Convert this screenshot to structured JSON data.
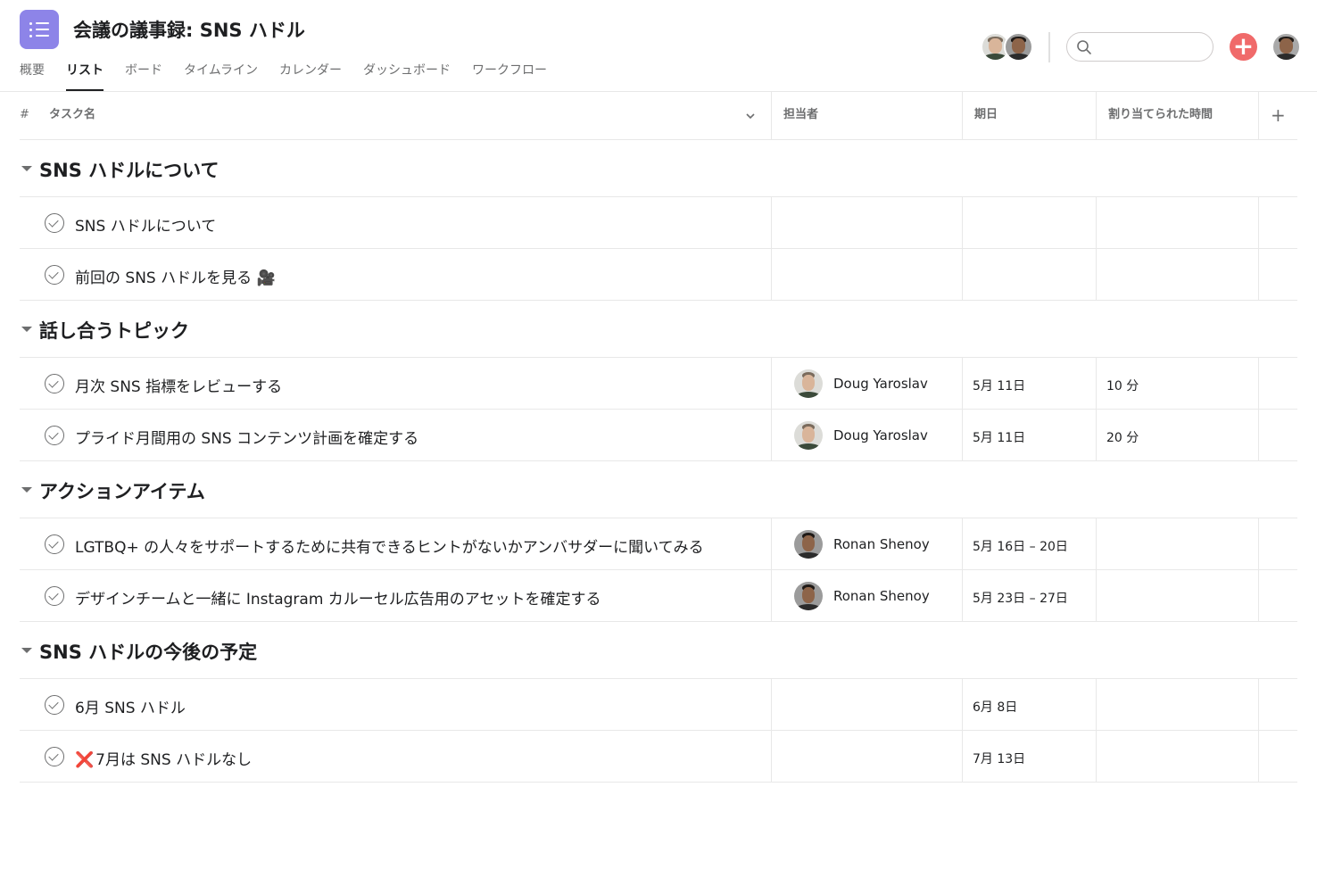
{
  "project": {
    "title": "会議の議事録: SNS ハドル",
    "icon": "list-icon",
    "accent": "#8d84e8"
  },
  "tabs": [
    {
      "label": "概要"
    },
    {
      "label": "リスト",
      "active": true
    },
    {
      "label": "ボード"
    },
    {
      "label": "タイムライン"
    },
    {
      "label": "カレンダー"
    },
    {
      "label": "ダッシュボード"
    },
    {
      "label": "ワークフロー"
    }
  ],
  "toolbar": {
    "add_label": "+",
    "add_color": "#f06a6a",
    "search_placeholder": ""
  },
  "columns": {
    "number": "#",
    "task_name": "タスク名",
    "assignee": "担当者",
    "due_date": "期日",
    "allocated_time": "割り当てられた時間",
    "add": "+"
  },
  "sections": [
    {
      "title": "SNS ハドルについて",
      "tasks": [
        {
          "name": "SNS ハドルについて",
          "assignee": "",
          "due": "",
          "time": ""
        },
        {
          "name": "前回の SNS ハドルを見る 🎥",
          "assignee": "",
          "due": "",
          "time": ""
        }
      ]
    },
    {
      "title": "話し合うトピック",
      "tasks": [
        {
          "name": "月次 SNS 指標をレビューする",
          "assignee": "Doug Yaroslav",
          "due": "5月 11日",
          "time": "10 分"
        },
        {
          "name": "プライド月間用の SNS コンテンツ計画を確定する",
          "assignee": "Doug Yaroslav",
          "due": "5月 11日",
          "time": "20 分"
        }
      ]
    },
    {
      "title": "アクションアイテム",
      "tasks": [
        {
          "name": "LGTBQ+ の人々をサポートするために共有できるヒントがないかアンバサダーに聞いてみる",
          "assignee": "Ronan Shenoy",
          "due": "5月 16日 – 20日",
          "time": ""
        },
        {
          "name": "デザインチームと一緒に Instagram カルーセル広告用のアセットを確定する",
          "assignee": "Ronan Shenoy",
          "due": "5月 23日 – 27日",
          "time": ""
        }
      ]
    },
    {
      "title": "SNS ハドルの今後の予定",
      "tasks": [
        {
          "name": "6月 SNS ハドル",
          "assignee": "",
          "due": "6月 8日",
          "time": ""
        },
        {
          "name": "7月は SNS ハドルなし",
          "prefix": "❌",
          "assignee": "",
          "due": "7月 13日",
          "time": ""
        }
      ]
    }
  ]
}
